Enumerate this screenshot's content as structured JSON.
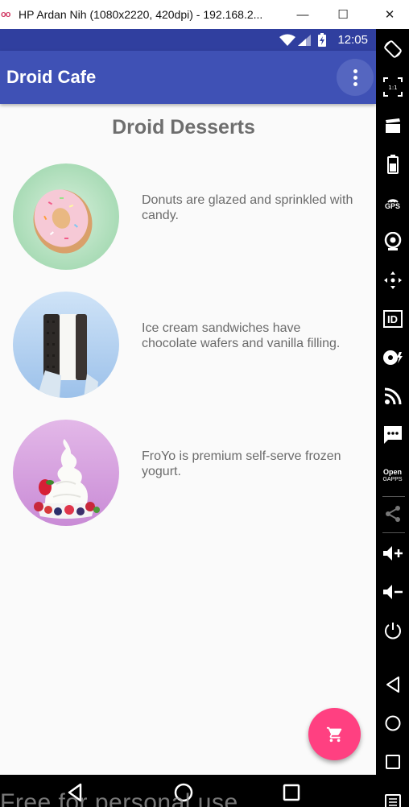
{
  "window": {
    "title": "HP Ardan Nih (1080x2220, 420dpi) - 192.168.2...",
    "logo": "oo",
    "minimize": "—",
    "maximize": "☐",
    "close": "✕"
  },
  "status_bar": {
    "time": "12:05"
  },
  "app_bar": {
    "title": "Droid Cafe"
  },
  "main": {
    "heading": "Droid Desserts",
    "items": [
      {
        "image": "donut",
        "description": "Donuts are glazed and sprinkled with candy."
      },
      {
        "image": "ice-cream-sandwich",
        "description": "Ice cream sandwiches have chocolate wafers and vanilla filling."
      },
      {
        "image": "froyo",
        "description": "FroYo is premium self-serve frozen yogurt."
      }
    ]
  },
  "fab": {
    "icon": "shopping-cart-icon",
    "color": "#ff4081"
  },
  "watermark": "Free for personal use",
  "side_panel": {
    "gps_label": "GPS",
    "id_label": "ID",
    "opengapps_label_1": "Open",
    "opengapps_label_2": "GAPPS"
  },
  "colors": {
    "primary": "#3f51b5",
    "primary_dark": "#303f9f",
    "accent": "#ff4081"
  }
}
